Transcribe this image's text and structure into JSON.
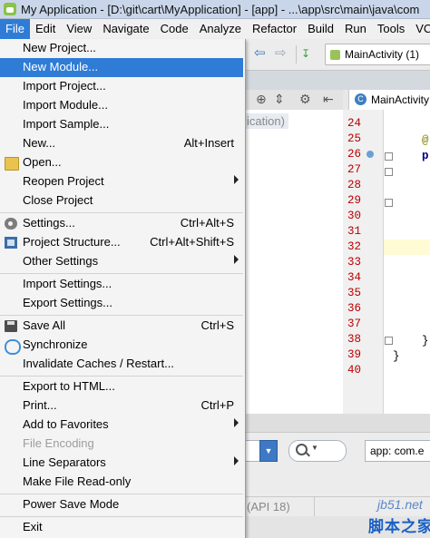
{
  "window": {
    "title": "My Application - [D:\\git\\cart\\MyApplication] - [app] - ...\\app\\src\\main\\java\\com"
  },
  "menubar": [
    "File",
    "Edit",
    "View",
    "Navigate",
    "Code",
    "Analyze",
    "Refactor",
    "Build",
    "Run",
    "Tools",
    "VCS"
  ],
  "toolbar": {
    "run_config": "MainActivity (1)"
  },
  "editor": {
    "tab": "MainActivity",
    "tab_icon": "C",
    "line_numbers": [
      "24",
      "25",
      "26",
      "27",
      "28",
      "29",
      "30",
      "31",
      "32",
      "33",
      "34",
      "35",
      "36",
      "37",
      "38",
      "39",
      "40"
    ],
    "project_hint": "ication)"
  },
  "findbar": {
    "app_field": "app: com.e"
  },
  "status": {
    "api": "(API 18)"
  },
  "watermark": {
    "site": "jb51.net",
    "brand": "脚本之家"
  },
  "file_menu": {
    "items": [
      {
        "label": "New Project...",
        "shortcut": ""
      },
      {
        "label": "New Module...",
        "shortcut": "",
        "highlighted": true
      },
      {
        "label": "Import Project...",
        "shortcut": ""
      },
      {
        "label": "Import Module...",
        "shortcut": ""
      },
      {
        "label": "Import Sample...",
        "shortcut": ""
      },
      {
        "label": "New...",
        "shortcut": "Alt+Insert"
      },
      {
        "label": "Open...",
        "shortcut": "",
        "icon": "folder-icon"
      },
      {
        "label": "Reopen Project",
        "shortcut": "",
        "submenu": true
      },
      {
        "label": "Close Project",
        "shortcut": ""
      },
      {
        "label": "Settings...",
        "shortcut": "Ctrl+Alt+S",
        "icon": "settings-gear-icon"
      },
      {
        "label": "Project Structure...",
        "shortcut": "Ctrl+Alt+Shift+S",
        "icon": "project-structure-icon"
      },
      {
        "label": "Other Settings",
        "shortcut": "",
        "submenu": true
      },
      {
        "label": "Import Settings...",
        "shortcut": ""
      },
      {
        "label": "Export Settings...",
        "shortcut": ""
      },
      {
        "label": "Save All",
        "shortcut": "Ctrl+S",
        "icon": "save-icon"
      },
      {
        "label": "Synchronize",
        "shortcut": "",
        "icon": "sync-icon"
      },
      {
        "label": "Invalidate Caches / Restart...",
        "shortcut": ""
      },
      {
        "label": "Export to HTML...",
        "shortcut": ""
      },
      {
        "label": "Print...",
        "shortcut": "Ctrl+P",
        "icon": "print-icon"
      },
      {
        "label": "Add to Favorites",
        "shortcut": "",
        "submenu": true
      },
      {
        "label": "File Encoding",
        "shortcut": "",
        "disabled": true
      },
      {
        "label": "Line Separators",
        "shortcut": "",
        "submenu": true
      },
      {
        "label": "Make File Read-only",
        "shortcut": ""
      },
      {
        "label": "Power Save Mode",
        "shortcut": ""
      },
      {
        "label": "Exit",
        "shortcut": ""
      }
    ]
  },
  "colors": {
    "menu_highlight": "#2f7cd6",
    "line_number": "#bb0000"
  }
}
